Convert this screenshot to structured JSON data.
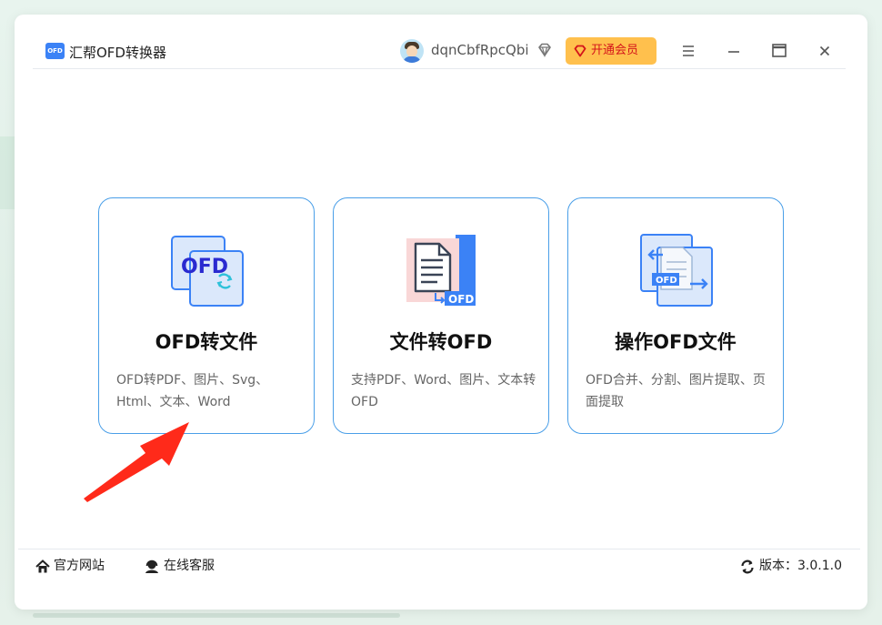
{
  "window": {
    "app_title": "汇帮OFD转换器",
    "logo_text": "OFD",
    "username": "dqnCbfRpcQbi",
    "vip_label": "开通会员"
  },
  "cards": [
    {
      "title": "OFD转文件",
      "desc": "OFD转PDF、图片、Svg、Html、文本、Word",
      "icon": "ofd-convert-icon",
      "icon_text": "OFD"
    },
    {
      "title": "文件转OFD",
      "desc": "支持PDF、Word、图片、文本转OFD",
      "icon": "file-to-ofd-icon",
      "icon_text": "OFD"
    },
    {
      "title": "操作OFD文件",
      "desc": "OFD合并、分割、图片提取、页面提取",
      "icon": "ofd-operate-icon",
      "icon_text": "OFD"
    }
  ],
  "footer": {
    "site_label": "官方网站",
    "service_label": "在线客服",
    "version_label": "版本：3.0.1.0"
  },
  "colors": {
    "accent": "#3b82f6",
    "card_border": "#4a9fe8",
    "vip_bg": "#ffc04d",
    "vip_text": "#d4141a",
    "annotation": "#ff2a1a"
  }
}
